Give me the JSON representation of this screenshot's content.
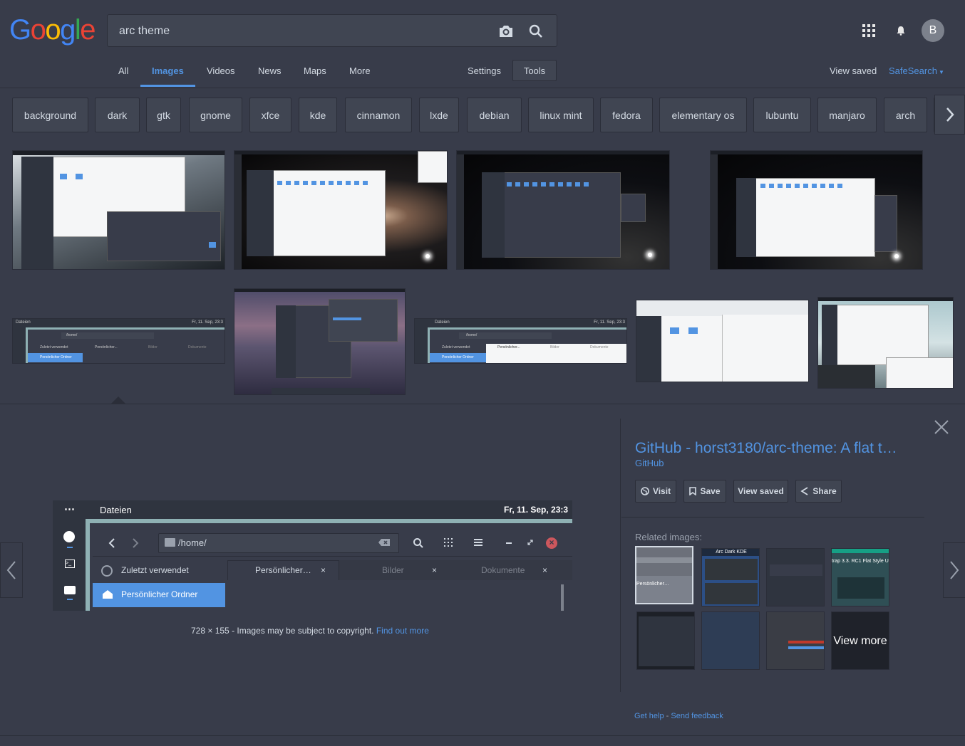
{
  "logo": {
    "letters": [
      "G",
      "o",
      "o",
      "g",
      "l",
      "e"
    ],
    "colors": [
      "#4285f4",
      "#ea4335",
      "#fbbc05",
      "#4285f4",
      "#34a853",
      "#ea4335"
    ]
  },
  "search": {
    "query": "arc theme"
  },
  "header": {
    "avatar_letter": "B"
  },
  "tabs": [
    {
      "label": "All",
      "active": false
    },
    {
      "label": "Images",
      "active": true
    },
    {
      "label": "Videos",
      "active": false
    },
    {
      "label": "News",
      "active": false
    },
    {
      "label": "Maps",
      "active": false
    },
    {
      "label": "More",
      "active": false
    }
  ],
  "toolbar": {
    "settings": "Settings",
    "tools": "Tools",
    "view_saved": "View saved",
    "safesearch": "SafeSearch"
  },
  "chips": [
    "background",
    "dark",
    "gtk",
    "gnome",
    "xfce",
    "kde",
    "cinnamon",
    "lxde",
    "debian",
    "linux mint",
    "fedora",
    "elementary os",
    "lubuntu",
    "manjaro",
    "arch"
  ],
  "thumbs_row2": {
    "t1": {
      "title": "Dateien",
      "time": "Fr, 11. Sep, 23:3",
      "path": "/home/",
      "recent": "Zuletzt verwendet",
      "home": "Persönlicher Ordner",
      "tab1": "Persönlicher...",
      "tab2": "Bilder",
      "tab3": "Dokumente"
    },
    "t3": {
      "title": "Dateien",
      "time": "Fr, 11. Sep, 23:3",
      "path": "/home/",
      "recent": "Zuletzt verwendet",
      "home": "Persönlicher Ordner",
      "tab1": "Persönlicher...",
      "tab2": "Bilder",
      "tab3": "Dokumente"
    }
  },
  "preview": {
    "dots": "⋯",
    "title": "Dateien",
    "time": "Fr, 11. Sep, 23:3",
    "path": "/home/",
    "recent": "Zuletzt verwendet",
    "home": "Persönlicher Ordner",
    "tab1": "Persönlicher…",
    "tab2": "Bilder",
    "tab3": "Dokumente",
    "tab_close": "×"
  },
  "copyright": {
    "dimensions": "728 × 155",
    "sep": "-",
    "text": "Images may be subject to copyright.",
    "link": "Find out more"
  },
  "result": {
    "title": "GitHub - horst3180/arc-theme: A flat t…",
    "source": "GitHub"
  },
  "actions": {
    "visit": "Visit",
    "save": "Save",
    "view_saved": "View saved",
    "share": "Share"
  },
  "related": {
    "label": "Related images:",
    "r1_text": "Persönlicher…",
    "r2_text": "Arc Dark KDE",
    "r4_text": "trap 3.3. RC1 Flat Style U",
    "view_more": "View more"
  },
  "footer": {
    "help": "Get help",
    "sep": "-",
    "feedback": "Send feedback"
  }
}
